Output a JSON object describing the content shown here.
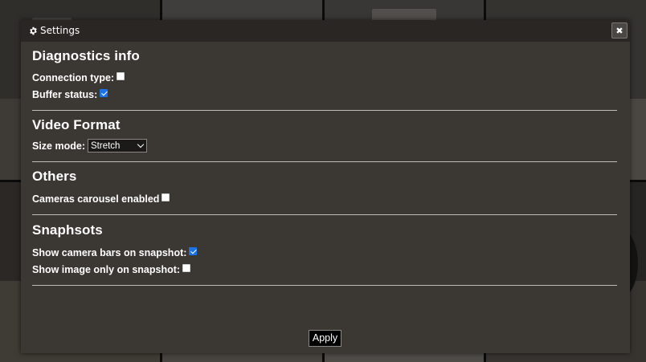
{
  "dialog": {
    "title": "Settings",
    "title_icon": "gear-icon",
    "close_icon": "close-icon",
    "close_symbol": "✖"
  },
  "sections": {
    "diagnostics": {
      "heading": "Diagnostics info",
      "connection_type": {
        "label": "Connection type:",
        "checked": false
      },
      "buffer_status": {
        "label": "Buffer status:",
        "checked": true
      }
    },
    "video_format": {
      "heading": "Video Format",
      "size_mode": {
        "label": "Size mode:",
        "value": "Stretch"
      }
    },
    "others": {
      "heading": "Others",
      "cameras_carousel": {
        "label": "Cameras carousel enabled",
        "checked": false
      }
    },
    "snapshots": {
      "heading": "Snaphsots",
      "show_camera_bars": {
        "label": "Show camera bars on snapshot:",
        "checked": true
      },
      "show_image_only": {
        "label": "Show image only on snapshot:",
        "checked": false
      }
    }
  },
  "footer": {
    "apply_label": "Apply"
  },
  "colors": {
    "dialog_bg": "#3b3733",
    "titlebar_bg": "#2a2623",
    "checkbox_accent": "#1a73e8",
    "divider": "#bdbab6"
  }
}
